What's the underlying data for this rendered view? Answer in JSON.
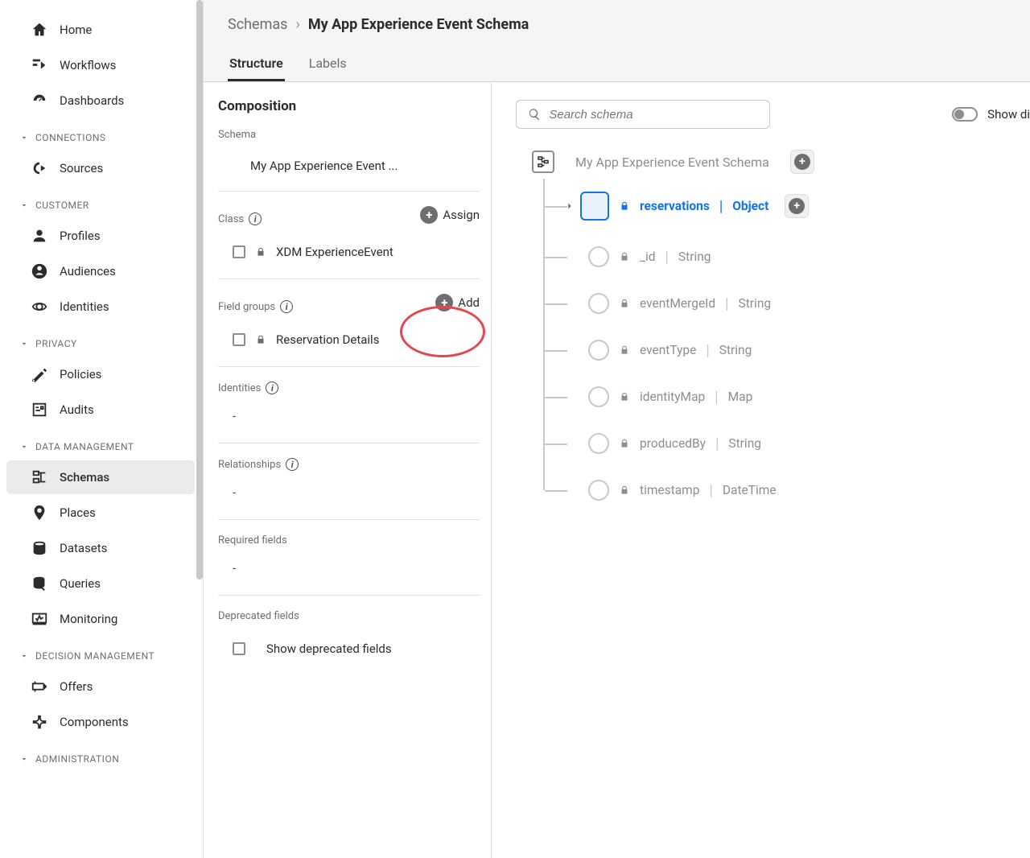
{
  "sidebar": {
    "items_top": [
      {
        "label": "Home",
        "icon": "home"
      },
      {
        "label": "Workflows",
        "icon": "workflows"
      },
      {
        "label": "Dashboards",
        "icon": "dashboards"
      }
    ],
    "sections": [
      {
        "label": "CONNECTIONS",
        "items": [
          {
            "label": "Sources",
            "icon": "sources"
          }
        ]
      },
      {
        "label": "CUSTOMER",
        "items": [
          {
            "label": "Profiles",
            "icon": "profiles"
          },
          {
            "label": "Audiences",
            "icon": "audiences"
          },
          {
            "label": "Identities",
            "icon": "identities"
          }
        ]
      },
      {
        "label": "PRIVACY",
        "items": [
          {
            "label": "Policies",
            "icon": "policies"
          },
          {
            "label": "Audits",
            "icon": "audits"
          }
        ]
      },
      {
        "label": "DATA MANAGEMENT",
        "items": [
          {
            "label": "Schemas",
            "icon": "schemas",
            "selected": true
          },
          {
            "label": "Places",
            "icon": "places"
          },
          {
            "label": "Datasets",
            "icon": "datasets"
          },
          {
            "label": "Queries",
            "icon": "queries"
          },
          {
            "label": "Monitoring",
            "icon": "monitoring"
          }
        ]
      },
      {
        "label": "DECISION MANAGEMENT",
        "items": [
          {
            "label": "Offers",
            "icon": "offers"
          },
          {
            "label": "Components",
            "icon": "components"
          }
        ]
      },
      {
        "label": "ADMINISTRATION",
        "items": []
      }
    ]
  },
  "breadcrumb": {
    "root": "Schemas",
    "sep": "›",
    "current": "My App Experience Event Schema"
  },
  "tabs": [
    {
      "label": "Structure",
      "active": true
    },
    {
      "label": "Labels"
    }
  ],
  "composition": {
    "title": "Composition",
    "schema_label": "Schema",
    "schema_name": "My App Experience Event ...",
    "class_label": "Class",
    "assign_label": "Assign",
    "class_name": "XDM ExperienceEvent",
    "fieldgroups_label": "Field groups",
    "add_label": "Add",
    "fieldgroup_name": "Reservation Details",
    "identities_label": "Identities",
    "relationships_label": "Relationships",
    "required_label": "Required fields",
    "deprecated_label": "Deprecated fields",
    "show_deprecated_label": "Show deprecated fields",
    "dash": "-"
  },
  "canvas": {
    "search_placeholder": "Search schema",
    "toggle_label": "Show di",
    "root_name": "My App Experience Event Schema",
    "fields": [
      {
        "name": "reservations",
        "type": "Object",
        "selected": true,
        "expandable": true
      },
      {
        "name": "_id",
        "type": "String"
      },
      {
        "name": "eventMergeId",
        "type": "String"
      },
      {
        "name": "eventType",
        "type": "String"
      },
      {
        "name": "identityMap",
        "type": "Map"
      },
      {
        "name": "producedBy",
        "type": "String"
      },
      {
        "name": "timestamp",
        "type": "DateTime"
      }
    ]
  }
}
